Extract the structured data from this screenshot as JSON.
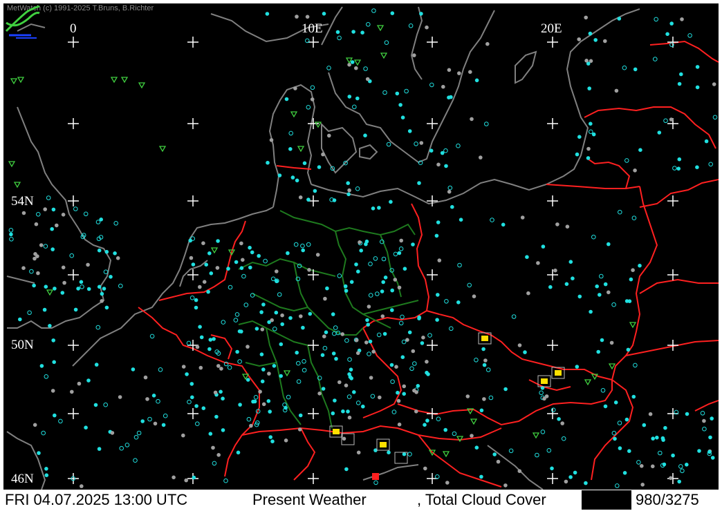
{
  "credit": "MetWatch  (c) 1991-2025 T.Bruns, B.Richter",
  "grid_labels": {
    "lon": [
      "0",
      "10E",
      "20E"
    ],
    "lat": [
      "54N",
      "50N",
      "46N"
    ]
  },
  "status_bar": {
    "datetime": "FRI 04.07.2025 13:00 UTC",
    "product": "Present Weather",
    "parameter": ", Total Cloud Cover",
    "counter": "980/3275"
  },
  "colors": {
    "background": "#000000",
    "coastline": "#808080",
    "country_border": "#ff2020",
    "state_border": "#1e7a1e",
    "cloud_station": "#20e0e0",
    "weather_symbol": "#40d040",
    "grid": "#ffffff"
  },
  "legend_icon": "metwatch-logo-icon"
}
